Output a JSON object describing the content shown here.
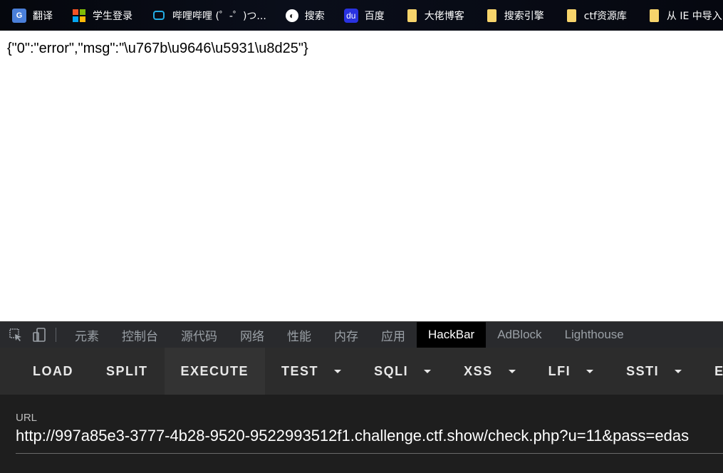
{
  "bookmarks": [
    {
      "label": "翻译",
      "icon": "google-translate-icon"
    },
    {
      "label": "学生登录",
      "icon": "microsoft-icon"
    },
    {
      "label": "哔哩哔哩 (゜-゜)つ...",
      "icon": "bilibili-icon"
    },
    {
      "label": "搜索",
      "icon": "globe-icon"
    },
    {
      "label": "百度",
      "icon": "baidu-paw-icon"
    },
    {
      "label": "大佬博客",
      "icon": "folder-icon"
    },
    {
      "label": "搜索引擎",
      "icon": "folder-icon"
    },
    {
      "label": "ctf资源库",
      "icon": "folder-icon"
    },
    {
      "label": "从 IE 中导入",
      "icon": "folder-icon"
    }
  ],
  "page": {
    "body_text": "{\"0\":\"error\",\"msg\":\"\\u767b\\u9646\\u5931\\u8d25\"}"
  },
  "devtools": {
    "tabs": [
      "元素",
      "控制台",
      "源代码",
      "网络",
      "性能",
      "内存",
      "应用",
      "HackBar",
      "AdBlock",
      "Lighthouse"
    ],
    "active_tab": "HackBar"
  },
  "hackbar": {
    "buttons": {
      "load": "LOAD",
      "split": "SPLIT",
      "execute": "EXECUTE",
      "test": "TEST",
      "sqli": "SQLI",
      "xss": "XSS",
      "lfi": "LFI",
      "ssti": "SSTI",
      "encoding": "EN"
    },
    "url_label": "URL",
    "url_value": "http://997a85e3-3777-4b28-9520-9522993512f1.challenge.ctf.show/check.php?u=11&pass=edas"
  },
  "colors": {
    "bookmark_bar_bg": "#070a12",
    "devtools_bg": "#292a2d",
    "hackbar_bg": "#2c2c2c",
    "url_area_bg": "#1e1e1e",
    "active_tab_bg": "#000000"
  }
}
